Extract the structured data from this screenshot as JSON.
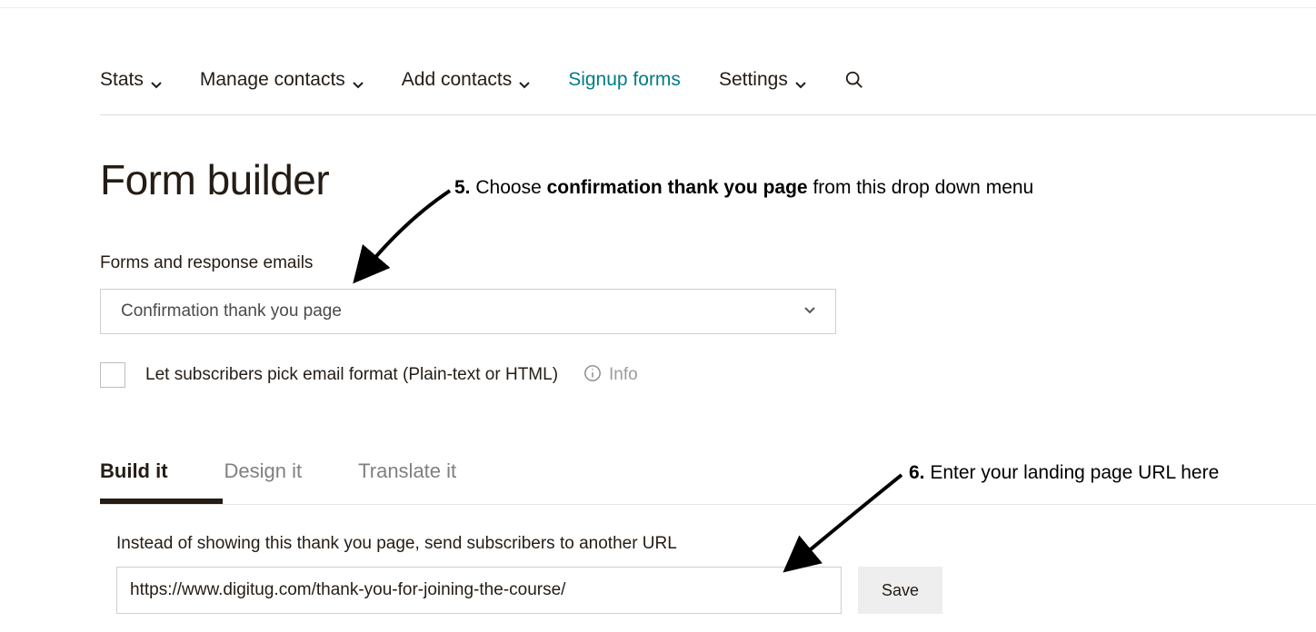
{
  "nav": {
    "items": [
      {
        "label": "Stats",
        "has_menu": true
      },
      {
        "label": "Manage contacts",
        "has_menu": true
      },
      {
        "label": "Add contacts",
        "has_menu": true
      },
      {
        "label": "Signup forms",
        "has_menu": false
      },
      {
        "label": "Settings",
        "has_menu": true
      }
    ]
  },
  "page_title": "Form builder",
  "forms_section": {
    "label": "Forms and response emails",
    "dropdown_value": "Confirmation thank you page",
    "checkbox_label": "Let subscribers pick email format (Plain-text or HTML)",
    "info_label": "Info"
  },
  "tabs": {
    "items": [
      "Build it",
      "Design it",
      "Translate it"
    ]
  },
  "url_section": {
    "label": "Instead of showing this thank you page, send subscribers to another URL",
    "input_value": "https://www.digitug.com/thank-you-for-joining-the-course/",
    "save_label": "Save"
  },
  "annotations": {
    "a5_prefix": "5. ",
    "a5_before": "Choose ",
    "a5_bold": "confirmation thank you page",
    "a5_after": " from this drop down menu",
    "a6_prefix": "6. ",
    "a6_text": "Enter your landing page URL here"
  }
}
